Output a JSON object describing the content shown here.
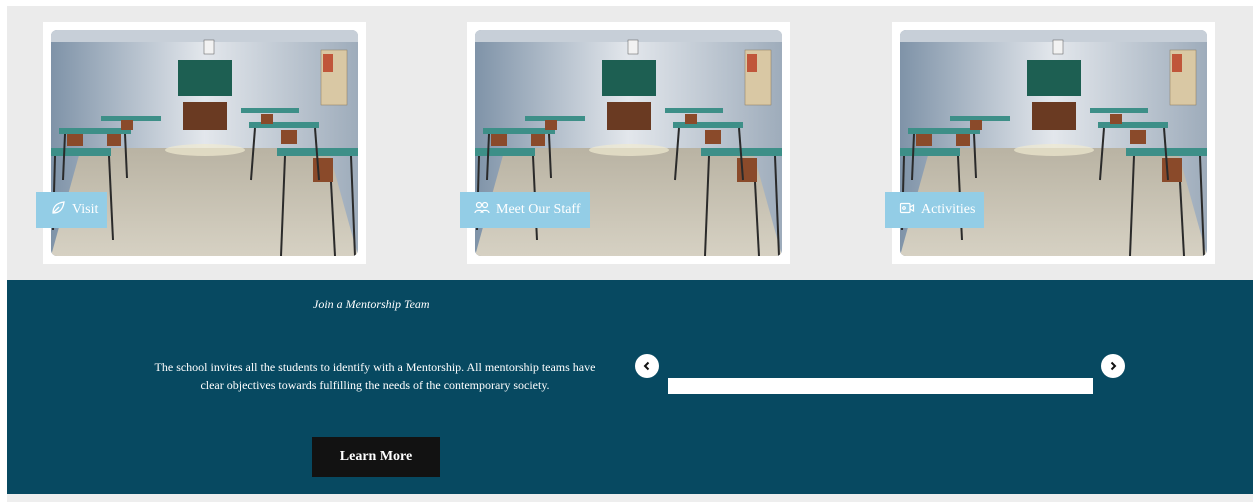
{
  "cards": [
    {
      "label": "Visit",
      "icon": "leaf-icon"
    },
    {
      "label": "Meet Our Staff",
      "icon": "users-icon"
    },
    {
      "label": "Activities",
      "icon": "video-camera-icon"
    }
  ],
  "mentorship": {
    "title": "Join a Mentorship Team",
    "description": "The school invites all the students to identify with a Mentorship. All mentorship teams have clear objectives towards fulfilling the needs of the contemporary society.",
    "button_label": "Learn More"
  },
  "colors": {
    "band": "#074961",
    "tag": "#93cde6",
    "button": "#121212",
    "page_bg": "#ebebeb"
  }
}
